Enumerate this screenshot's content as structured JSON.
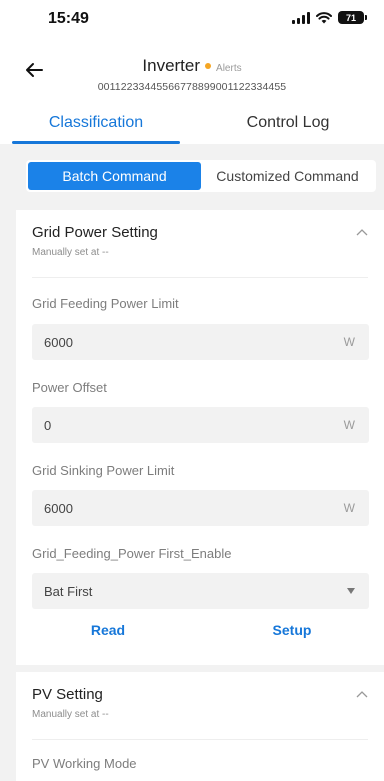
{
  "status": {
    "time": "15:49",
    "battery": "71"
  },
  "header": {
    "title": "Inverter",
    "alerts": "Alerts",
    "serial": "00112233445566778899001122334455"
  },
  "tabs": [
    {
      "label": "Classification",
      "active": true
    },
    {
      "label": "Control Log",
      "active": false
    }
  ],
  "segment": [
    {
      "label": "Batch Command",
      "active": true
    },
    {
      "label": "Customized Command",
      "active": false
    }
  ],
  "grid_power": {
    "title": "Grid Power Setting",
    "subtitle": "Manually set at --",
    "fields": [
      {
        "label": "Grid Feeding Power Limit",
        "value": "6000",
        "unit": "W"
      },
      {
        "label": "Power Offset",
        "value": "0",
        "unit": "W"
      },
      {
        "label": "Grid Sinking Power Limit",
        "value": "6000",
        "unit": "W"
      },
      {
        "label": "Grid_Feeding_Power First_Enable",
        "value": "Bat First"
      }
    ],
    "read_label": "Read",
    "setup_label": "Setup"
  },
  "pv": {
    "title": "PV Setting",
    "subtitle": "Manually set at --",
    "working_mode_label": "PV Working Mode"
  },
  "colors": {
    "accent": "#1677d9",
    "alert_dot": "#f5a623",
    "segment_active": "#1b82e8"
  }
}
